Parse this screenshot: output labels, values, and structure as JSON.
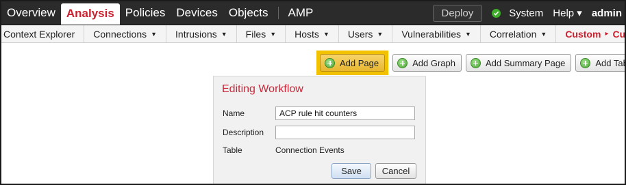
{
  "topnav": {
    "items": [
      {
        "label": "Overview",
        "active": false
      },
      {
        "label": "Analysis",
        "active": true
      },
      {
        "label": "Policies",
        "active": false
      },
      {
        "label": "Devices",
        "active": false
      },
      {
        "label": "Objects",
        "active": false
      },
      {
        "label": "AMP",
        "active": false
      }
    ],
    "deploy_label": "Deploy",
    "status_icon": "check-circle-icon",
    "system_label": "System",
    "help_label": "Help ▾",
    "user_label": "admin"
  },
  "subnav": {
    "items": [
      {
        "label": "Context Explorer",
        "caret": ""
      },
      {
        "label": "Connections",
        "caret": "▼"
      },
      {
        "label": "Intrusions",
        "caret": "▼"
      },
      {
        "label": "Files",
        "caret": "▼"
      },
      {
        "label": "Hosts",
        "caret": "▼"
      },
      {
        "label": "Users",
        "caret": "▼"
      },
      {
        "label": "Vulnerabilities",
        "caret": "▼"
      },
      {
        "label": "Correlation",
        "caret": "▼"
      }
    ],
    "active": {
      "part1": "Custom",
      "separator": "▸",
      "part2": "Custom"
    }
  },
  "toolbar": {
    "add_page": "Add Page",
    "add_graph": "Add Graph",
    "add_summary_page": "Add Summary Page",
    "add_table_view": "Add Table View"
  },
  "panel": {
    "title": "Editing Workflow",
    "name_label": "Name",
    "name_value": "ACP rule hit counters",
    "description_label": "Description",
    "description_value": "",
    "table_label": "Table",
    "table_value": "Connection Events",
    "save_label": "Save",
    "cancel_label": "Cancel"
  },
  "colors": {
    "accent_red": "#cc1f2e",
    "topbar_bg": "#2b2b2b",
    "highlight_yellow": "#f2c200",
    "status_green": "#3fae2a"
  }
}
